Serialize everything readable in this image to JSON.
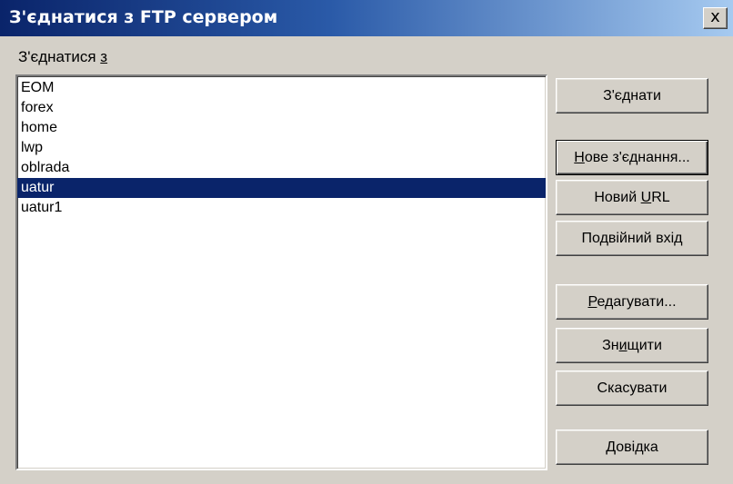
{
  "window": {
    "title": "З'єднатися з FTP сервером",
    "close_glyph": "x"
  },
  "connect_with": {
    "label_prefix": "З'єднатися ",
    "label_mnemonic": "з"
  },
  "connections": {
    "items": [
      "EOM",
      "forex",
      "home",
      "lwp",
      "oblrada",
      "uatur",
      "uatur1"
    ],
    "selected": "uatur"
  },
  "buttons": {
    "connect": {
      "label": "З'єднати"
    },
    "new_connection": {
      "mnemonic": "Н",
      "rest": "ове з'єднання..."
    },
    "new_url": {
      "prefix": "Новий ",
      "mnemonic": "U",
      "rest": "RL"
    },
    "double_login": {
      "label": "Подвійний вхід"
    },
    "edit": {
      "mnemonic": "Р",
      "rest": "едагувати..."
    },
    "delete": {
      "prefix": "Зн",
      "mnemonic": "и",
      "rest": "щити"
    },
    "cancel": {
      "label": "Скасувати"
    },
    "help": {
      "label": "Довідка"
    }
  }
}
